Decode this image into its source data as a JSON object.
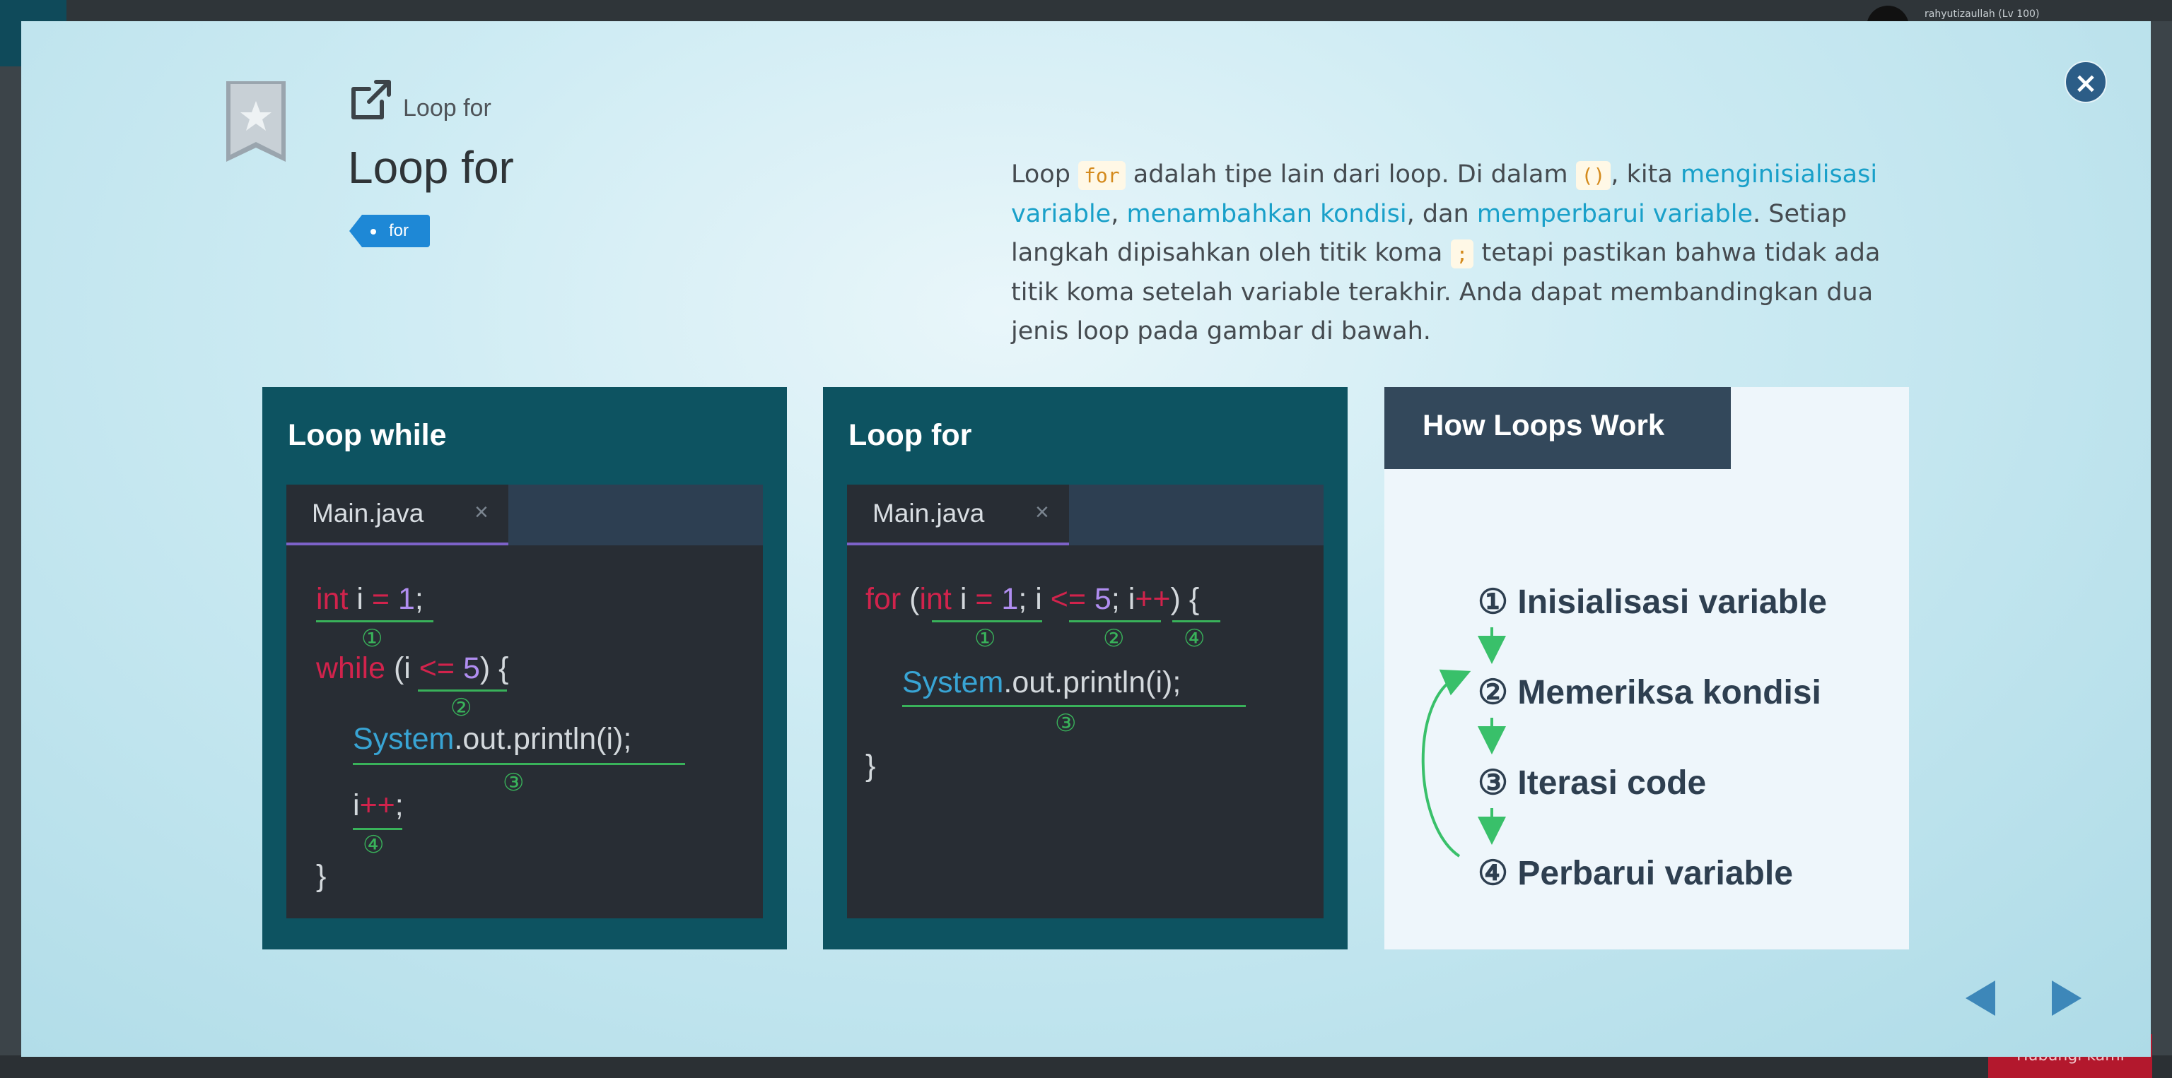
{
  "background": {
    "username": "rahyutizaullah (Lv 100)",
    "bottom_button": "Hubungi kami"
  },
  "modal": {
    "breadcrumb": "Loop for",
    "title": "Loop for",
    "tag": "for",
    "close_icon": "close-icon",
    "description": {
      "p1": "Loop ",
      "code_for": "for",
      "p2": " adalah tipe lain dari loop. Di dalam ",
      "code_parens": "()",
      "p3": ", kita ",
      "link1": "menginisialisasi variable",
      "p4": ", ",
      "link2": "menambahkan kondisi",
      "p5": ", dan ",
      "link3": "memperbarui variable",
      "p6": ". Setiap langkah dipisahkan oleh titik koma ",
      "code_semicolon": ";",
      "p7": " tetapi pastikan bahwa tidak ada titik koma setelah variable terakhir. Anda dapat membandingkan dua jenis loop pada gambar di bawah."
    }
  },
  "panel_while": {
    "title": "Loop while",
    "tab": "Main.java",
    "tab_close": "×",
    "l1_kw": "int",
    "l1_var": " i ",
    "l1_op": "=",
    "l1_num": " 1",
    "l1_end": ";",
    "l2_kw": "while",
    "l2_a": " (i ",
    "l2_op": "<=",
    "l2_num": " 5",
    "l2_b": ") {",
    "l3_sys": "System",
    "l3_rest": ".out.println(i);",
    "l4_var": "i",
    "l4_op": "++",
    "l4_end": ";",
    "l5": "}",
    "m1": "①",
    "m2": "②",
    "m3": "③",
    "m4": "④"
  },
  "panel_for": {
    "title": "Loop for",
    "tab": "Main.java",
    "tab_close": "×",
    "l1_kw": "for",
    "l1_a": " (",
    "l1_kw2": "int",
    "l1_b": " i ",
    "l1_op1": "=",
    "l1_num1": " 1",
    "l1_c": "; i ",
    "l1_op2": "<=",
    "l1_num2": " 5",
    "l1_d": "; i",
    "l1_op3": "++",
    "l1_e": ") {",
    "l2_sys": "System",
    "l2_rest": ".out.println(i);",
    "l3": "}",
    "m1": "①",
    "m2": "②",
    "m3": "③",
    "m4": "④"
  },
  "panel_how": {
    "title": "How Loops Work",
    "steps": [
      "① Inisialisasi variable",
      "② Memeriksa kondisi",
      "③ Iterasi code",
      "④ Perbarui variable"
    ]
  },
  "nav": {
    "prev_icon": "triangle-left-icon",
    "next_icon": "triangle-right-icon"
  },
  "colors": {
    "accent_link": "#19a0c9",
    "panel_dark": "#0d5361",
    "keyword": "#d1234c",
    "underline": "#39b25a"
  }
}
